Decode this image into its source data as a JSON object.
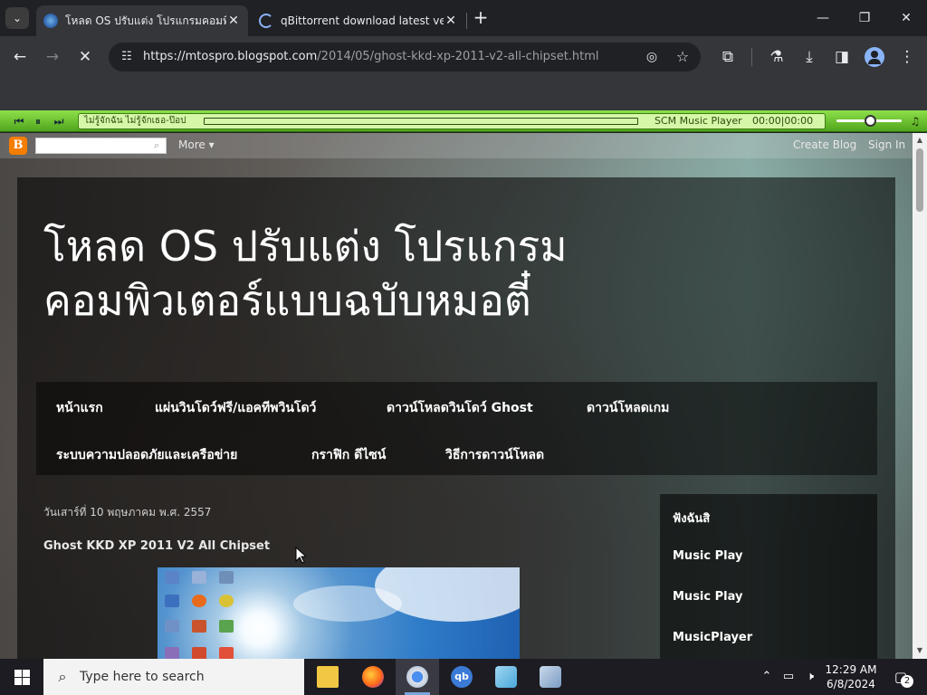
{
  "browser": {
    "tabs": [
      {
        "title": "โหลด OS ปรับแต่ง โปรแกรมคอมพิวเ",
        "active": true
      },
      {
        "title": "qBittorrent download latest ve",
        "active": false
      }
    ],
    "url_host": "https://mtospro.blogspot.com",
    "url_path": "/2014/05/ghost-kkd-xp-2011-v2-all-chipset.html"
  },
  "music_player": {
    "song": "ไม่รู้จักฉัน ไม่รู้จักเธอ-ป๊อป",
    "name": "SCM Music Player",
    "time": "00:00|00:00",
    "progress_fraction": 0.0
  },
  "blogger_bar": {
    "more": "More ▾",
    "create_blog": "Create Blog",
    "sign_in": "Sign In"
  },
  "blog": {
    "title_line1": "โหลด OS ปรับแต่ง โปรแกรม",
    "title_line2": "คอมพิวเตอร์แบบฉบับหมอตี๋",
    "nav": [
      "หน้าแรก",
      "แผ่นวินโดว์ฟรี/แอคทีพวินโดว์",
      "ดาวน์โหลดวินโดว์ Ghost",
      "ดาวน์โหลดเกม",
      "ระบบความปลอดภัยและเครือข่าย",
      "กราฟิก ดีไซน์",
      "วิธีการดาวน์โหลด"
    ],
    "post_date": "วันเสาร์ที่ 10 พฤษภาคม พ.ศ. 2557",
    "post_title": "Ghost KKD XP 2011 V2 All Chipset",
    "sidebar": [
      "ฟังฉันสิ",
      "Music Play",
      "Music Play",
      "MusicPlayer"
    ]
  },
  "taskbar": {
    "search_placeholder": "Type here to search",
    "time": "12:29 AM",
    "date": "6/8/2024",
    "notification_count": "2"
  },
  "colors": {
    "player_green": "#6cc634",
    "blogger_orange": "#f57d00"
  }
}
